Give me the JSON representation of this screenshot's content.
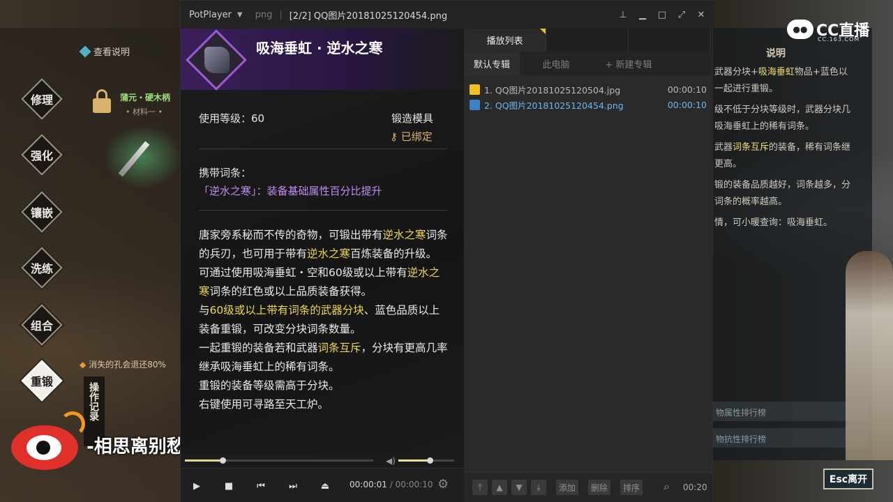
{
  "game": {
    "help_link": "查看说明",
    "menu": [
      "修理",
      "强化",
      "镶嵌",
      "洗练",
      "组合",
      "重锻"
    ],
    "active_menu_index": 5,
    "item_name": "蒲元・硬木柄",
    "item_sub": "• 材料一 •",
    "warning": "消失的孔会退还80%",
    "op_record": "操作记录",
    "right_title": "说明",
    "right_lines": [
      {
        "a": "武器分块+",
        "hl": "吸海垂虹",
        "b": "物品+蓝色以"
      },
      {
        "a": "一起进行重锻。",
        "hl": "",
        "b": ""
      },
      {
        "a": "级不低于分块等级时，武器分块几",
        "hl": "",
        "b": ""
      },
      {
        "a": "吸海垂虹上的稀有词条。",
        "hl": "",
        "b": ""
      },
      {
        "a": "武器",
        "hl": "词条互斥",
        "b": "的装备，稀有词条继"
      },
      {
        "a": "更高。",
        "hl": "",
        "b": ""
      },
      {
        "a": "锻的装备品质越好，词条越多，分",
        "hl": "",
        "b": ""
      },
      {
        "a": "词条的概率越高。",
        "hl": "",
        "b": ""
      },
      {
        "a": "情，可小暖查询：吸海垂虹。",
        "hl": "",
        "b": ""
      }
    ],
    "right_btn1": "物属性排行榜",
    "right_btn2": "物抗性排行榜",
    "esc_label": "Esc离开",
    "brand_logo": "CC直播",
    "brand_sub": "CC.163.COM",
    "watermark": "-相思离别愁-"
  },
  "player": {
    "app_name": "PotPlayer",
    "format": "png",
    "file_title": "[2/2] QQ图片20181025120454.png",
    "window_controls": [
      "pin-icon",
      "minimize-icon",
      "maximize-icon",
      "fullscreen-icon",
      "close-icon"
    ],
    "time_current": "00:00:01",
    "time_total": "/ 00:00:10",
    "seek_progress": 0.2,
    "volume_level": 0.56
  },
  "tooltip": {
    "title": "吸海垂虹 · 逆水之寒",
    "level_label": "使用等级：60",
    "type_label": "锻造模具",
    "bound_label": "已绑定",
    "affix_heading": "携带词条：",
    "affix_name": "「逆水之寒」",
    "affix_desc": "：装备基础属性百分比提升",
    "desc": {
      "p1a": "唐家旁系秘而不传的奇物，可锻出带有",
      "p1b": "逆水之寒",
      "p1c": "词条的兵刃，也可用于带有",
      "p1d": "逆水之寒",
      "p1e": "百炼装备的升级。",
      "p2a": "可通过使用吸海垂虹・空和60级或以上带有",
      "p2b": "逆水之寒",
      "p2c": "词条的红色或以上品质装备获得。",
      "p3a": "与",
      "p3b": "60级或以上带有词条的武器分块",
      "p3c": "、蓝色品质以上装备重锻，可改变分块词条数量。",
      "p4a": "一起重锻的装备若和武器",
      "p4b": "词条互斥",
      "p4c": "，分块有更高几率继承吸海垂虹上的稀有词条。",
      "p5": "重锻的装备等级需高于分块。",
      "p6": "右键使用可寻路至天工炉。"
    }
  },
  "playlist": {
    "tabs": [
      "播放列表",
      "",
      ""
    ],
    "album_tabs": [
      "默认专辑",
      "此电脑",
      "+ 新建专辑"
    ],
    "items": [
      {
        "name": "1. QQ图片20181025120504.jpg",
        "duration": "00:00:10",
        "current": false
      },
      {
        "name": "2. QQ图片20181025120454.png",
        "duration": "00:00:10",
        "current": true
      }
    ],
    "bottom_buttons": [
      "添加",
      "删除",
      "排序"
    ],
    "bottom_time": "00:20"
  },
  "colors": {
    "accent_yellow": "#f1d848",
    "affix_purple": "#c28cf0",
    "current_item_blue": "#6bb6ef",
    "weibo_red": "#e0302a"
  }
}
